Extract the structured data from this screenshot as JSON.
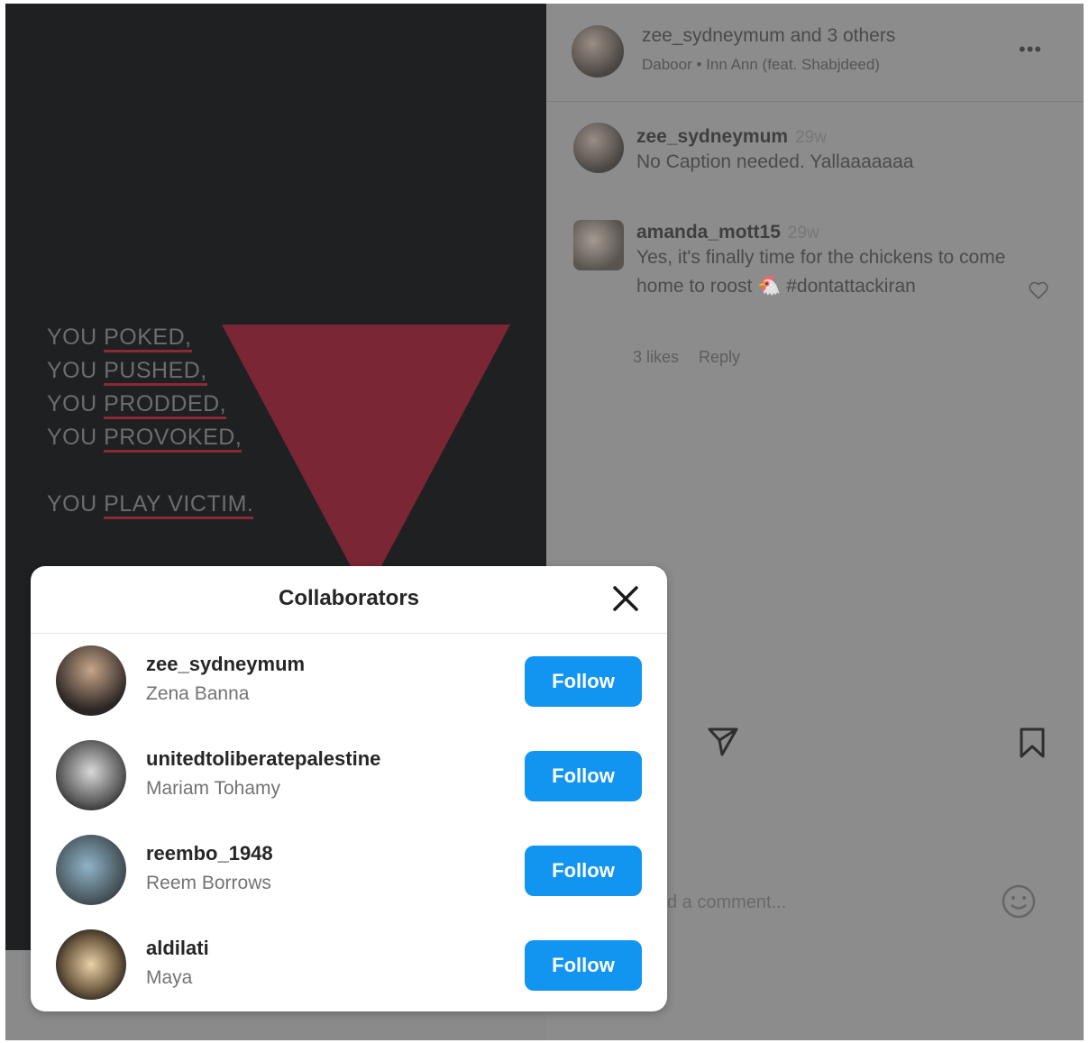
{
  "poster": {
    "lines": [
      "YOU POKED,",
      "YOU PUSHED,",
      "YOU PRODDED,",
      "YOU PROVOKED,",
      "YOU PLAY VICTIM."
    ],
    "accent_color": "#7a2634"
  },
  "header": {
    "user": "zee_sydneymum and 3 others",
    "audio": "Daboor • Inn Ann (feat. Shabjdeed)",
    "more_label": "•••"
  },
  "comments": [
    {
      "user": "zee_sydneymum",
      "time": "29w",
      "text": "No Caption needed. Yallaaaaaaa"
    },
    {
      "user": "amanda_mott15",
      "time": "29w",
      "text": "Yes, it's finally time for the chickens to come home to roost 🐔 #dontattackiran",
      "likes": "3 likes",
      "reply": "Reply"
    }
  ],
  "composer": {
    "placeholder": "d a comment..."
  },
  "modal": {
    "title": "Collaborators",
    "follow_label": "Follow",
    "collaborators": [
      {
        "username": "zee_sydneymum",
        "name": "Zena Banna"
      },
      {
        "username": "unitedtoliberatepalestine",
        "name": "Mariam Tohamy"
      },
      {
        "username": "reembo_1948",
        "name": "Reem Borrows"
      },
      {
        "username": "aldilati",
        "name": "Maya"
      }
    ]
  },
  "colors": {
    "follow_button": "#1195f0",
    "overlay": "#8c8c8c"
  }
}
